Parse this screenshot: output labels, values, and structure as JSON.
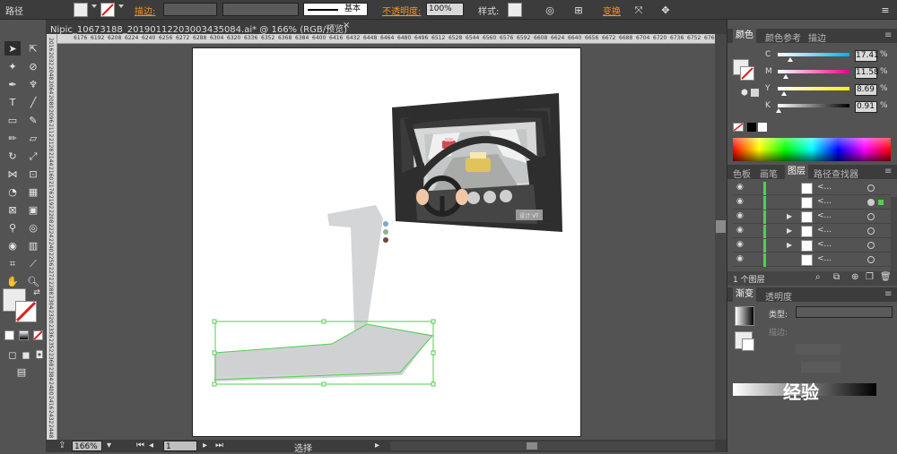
{
  "control_bar": {
    "path_label": "路径",
    "stroke_label": "描边:",
    "stroke_style": "基本",
    "opacity_label": "不透明度:",
    "opacity_value": "100%",
    "style_label": "样式:",
    "transform_label": "变换"
  },
  "document": {
    "tab_title": "Nipic_10673188_20190112203003435084.ai* @ 166% (RGB/预览)",
    "close_glyph": "×"
  },
  "rulers": {
    "horizontal_ticks": [
      "6176",
      "6192",
      "6208",
      "6224",
      "6240",
      "6256",
      "6272",
      "6288",
      "6304",
      "6320",
      "6336",
      "6352",
      "6368",
      "6384",
      "6400",
      "6416",
      "6432",
      "6448",
      "6464",
      "6480",
      "6496",
      "6512",
      "6528",
      "6544",
      "6560",
      "6576",
      "6592",
      "6608",
      "6624",
      "6640",
      "6656",
      "6672",
      "6688",
      "6704",
      "6720",
      "6736",
      "6752",
      "6768",
      "6784",
      "6800"
    ],
    "vertical_ticks": [
      "2016",
      "2032",
      "2048",
      "2064",
      "2080",
      "2096",
      "2112",
      "2128",
      "2144",
      "2160",
      "2176",
      "2192",
      "2208",
      "2224",
      "2240",
      "2256",
      "2272",
      "2288",
      "2304",
      "2320",
      "2336",
      "2352",
      "2368",
      "2384",
      "2400",
      "2416",
      "2432",
      "2448"
    ]
  },
  "status_bar": {
    "zoom": "166%",
    "artboard_num": "1",
    "tool_status": "选择"
  },
  "color_panel": {
    "tabs": [
      "颜色",
      "颜色参考",
      "描边"
    ],
    "channels": [
      {
        "label": "C",
        "value": "17.41",
        "unit": "%",
        "level": 0.1741,
        "gradient": "linear-gradient(to right,#fff,#00aeef)"
      },
      {
        "label": "M",
        "value": "11.58",
        "unit": "%",
        "level": 0.1158,
        "gradient": "linear-gradient(to right,#fff,#ec008c)"
      },
      {
        "label": "Y",
        "value": "8.69",
        "unit": "%",
        "level": 0.0869,
        "gradient": "linear-gradient(to right,#fff,#fff200)"
      },
      {
        "label": "K",
        "value": "0.91",
        "unit": "%",
        "level": 0.0091,
        "gradient": "linear-gradient(to right,#fff,#000)"
      }
    ]
  },
  "layers_panel": {
    "tabs": [
      "色板",
      "画笔",
      "图层",
      "路径查找器"
    ],
    "rows": [
      {
        "name": "<...",
        "expandable": false,
        "selected": false
      },
      {
        "name": "<...",
        "expandable": false,
        "selected": true
      },
      {
        "name": "<...",
        "expandable": true,
        "selected": false
      },
      {
        "name": "<...",
        "expandable": true,
        "selected": false
      },
      {
        "name": "<...",
        "expandable": true,
        "selected": false
      },
      {
        "name": "<...",
        "expandable": false,
        "selected": false
      }
    ],
    "footer_label": "1 个图层"
  },
  "gradient_panel": {
    "tabs": [
      "渐变",
      "透明度"
    ],
    "type_label": "类型:",
    "stroke_label": "描边:"
  },
  "art": {
    "sign_text": "设计 VT",
    "stand_color": "#d4d5d7",
    "frame_color": "#2e2e2e",
    "road_color": "#a9aba9"
  },
  "watermark": {
    "text": "经验"
  }
}
